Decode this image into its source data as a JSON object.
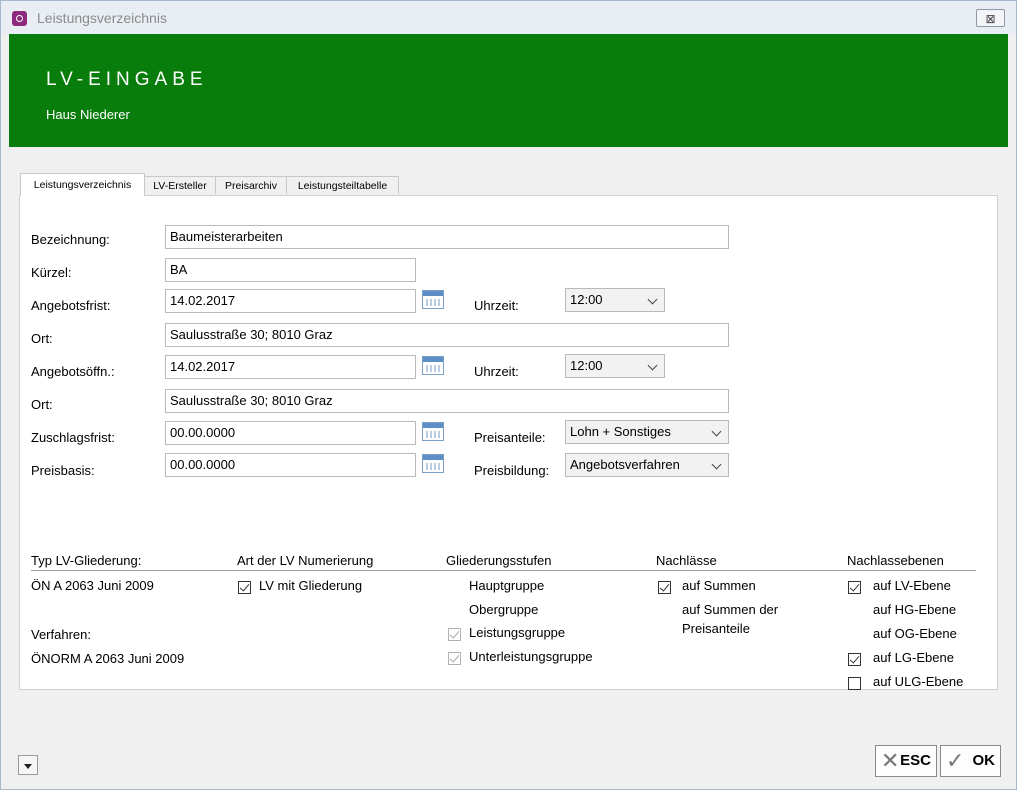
{
  "window": {
    "title": "Leistungsverzeichnis",
    "close_label": "⊠"
  },
  "banner": {
    "title": "LV-EINGABE",
    "subtitle": "Haus Niederer"
  },
  "tabs": [
    {
      "label": "Leistungsverzeichnis"
    },
    {
      "label": "LV-Ersteller"
    },
    {
      "label": "Preisarchiv"
    },
    {
      "label": "Leistungsteiltabelle"
    }
  ],
  "form": {
    "bezeichnung": {
      "label": "Bezeichnung:",
      "value": "Baumeisterarbeiten"
    },
    "kuerzel": {
      "label": "Kürzel:",
      "value": "BA"
    },
    "angebotsfrist": {
      "label": "Angebotsfrist:",
      "value": "14.02.2017",
      "time_label": "Uhrzeit:",
      "time_value": "12:00"
    },
    "ort1": {
      "label": "Ort:",
      "value": "Saulusstraße 30; 8010 Graz"
    },
    "angebotsoeffn": {
      "label": "Angebotsöffn.:",
      "value": "14.02.2017",
      "time_label": "Uhrzeit:",
      "time_value": "12:00"
    },
    "ort2": {
      "label": "Ort:",
      "value": "Saulusstraße 30; 8010 Graz"
    },
    "zuschlagsfrist": {
      "label": "Zuschlagsfrist:",
      "value": "00.00.0000"
    },
    "preisbasis": {
      "label": "Preisbasis:",
      "value": "00.00.0000"
    },
    "preisanteile": {
      "label": "Preisanteile:",
      "value": "Lohn + Sonstiges"
    },
    "preisbildung": {
      "label": "Preisbildung:",
      "value": "Angebotsverfahren"
    }
  },
  "sections": {
    "typ": {
      "header": "Typ LV-Gliederung:",
      "value": "ÖN A 2063 Juni 2009",
      "verfahren_label": "Verfahren:",
      "verfahren_value": "ÖNORM A 2063 Juni 2009"
    },
    "numerierung": {
      "header": "Art der LV Numerierung",
      "option": "LV mit Gliederung",
      "checked": true
    },
    "gliederung": {
      "header": "Gliederungsstufen",
      "items": [
        "Hauptgruppe",
        "Obergruppe",
        "Leistungsgruppe",
        "Unterleistungsgruppe"
      ]
    },
    "nachlaesse": {
      "header": "Nachlässe",
      "item1": "auf Summen",
      "item2": "auf Summen der",
      "item3": "Preisanteile"
    },
    "ebenen": {
      "header": "Nachlassebenen",
      "items": [
        "auf LV-Ebene",
        "auf HG-Ebene",
        "auf OG-Ebene",
        "auf LG-Ebene",
        "auf ULG-Ebene"
      ]
    }
  },
  "buttons": {
    "esc": "ESC",
    "ok": "OK"
  }
}
